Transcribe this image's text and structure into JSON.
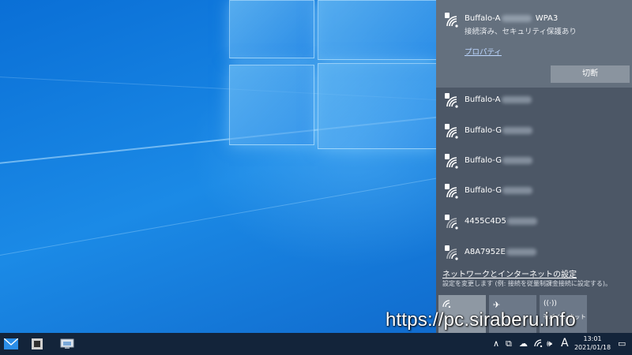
{
  "flyout": {
    "connected": {
      "name": "Buffalo-A",
      "security_suffix": "WPA3",
      "status": "接続済み、セキュリティ保護あり",
      "properties_link": "プロパティ",
      "disconnect_button": "切断"
    },
    "networks": [
      {
        "name": "Buffalo-A"
      },
      {
        "name": "Buffalo-G"
      },
      {
        "name": "Buffalo-G"
      },
      {
        "name": "Buffalo-G"
      },
      {
        "name": "4455C4D5"
      },
      {
        "name": "A8A7952E"
      }
    ],
    "settings_link": "ネットワークとインターネットの設定",
    "settings_sub": "設定を変更します (例: 接続を従量制課金接続に設定する)。",
    "tiles": [
      {
        "label": "",
        "icon": "wifi-icon",
        "active": true
      },
      {
        "label": "",
        "icon": "airplane-icon",
        "active": false
      },
      {
        "label": "モバイル ホット",
        "icon": "hotspot-icon",
        "active": false
      }
    ]
  },
  "watermark": "https://pc.siraberu.info",
  "taskbar": {
    "ime": "A",
    "time": "13:01",
    "date": "2021/01/18"
  }
}
